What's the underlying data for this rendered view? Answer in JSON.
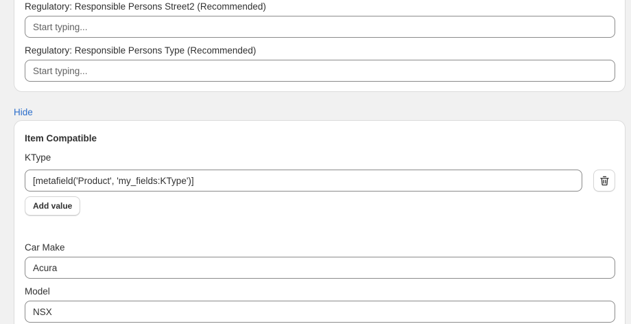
{
  "regulatory": {
    "street2": {
      "label": "Regulatory: Responsible Persons Street2 (Recommended)",
      "placeholder": "Start typing..."
    },
    "type": {
      "label": "Regulatory: Responsible Persons Type (Recommended)",
      "placeholder": "Start typing..."
    }
  },
  "hide_link": "Hide",
  "item_compatible": {
    "title": "Item Compatible",
    "ktype": {
      "label": "KType",
      "value": "[metafield('Product', 'my_fields:KType')]"
    },
    "add_value_label": "Add value",
    "car_make": {
      "label": "Car Make",
      "value": "Acura"
    },
    "model": {
      "label": "Model",
      "value": "NSX"
    }
  },
  "icons": {
    "delete": "trash-icon"
  },
  "colors": {
    "link": "#2c6ecb",
    "background": "#f1f1f1",
    "card": "#ffffff",
    "input_border": "#8a8a8a"
  }
}
